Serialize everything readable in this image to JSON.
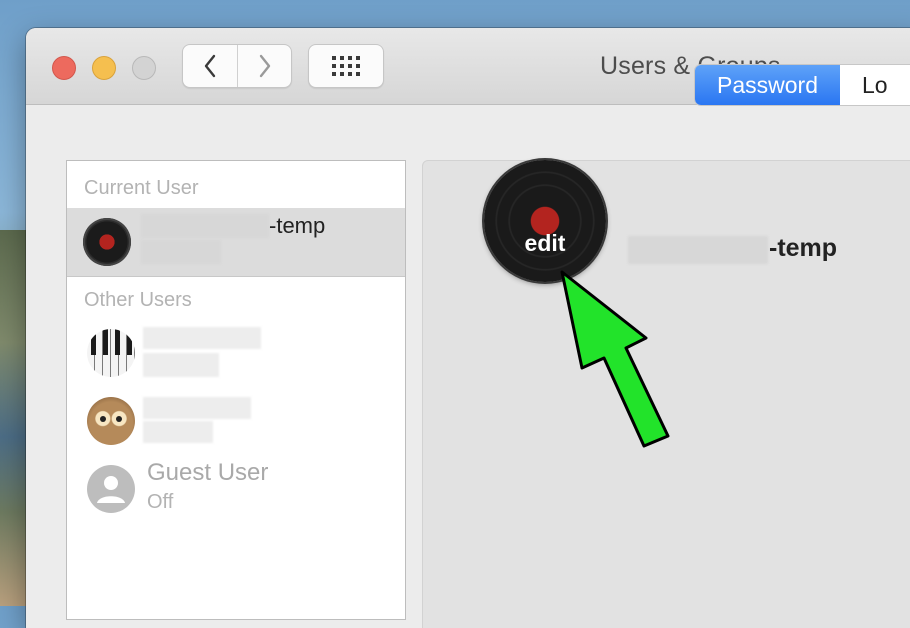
{
  "window": {
    "title": "Users & Groups"
  },
  "colors": {
    "close": "#ed6a5e",
    "minimize": "#f5bf4f",
    "accent": "#2a76f2",
    "arrow": "#22e32a"
  },
  "toolbar": {
    "back_icon": "chevron-left-icon",
    "forward_icon": "chevron-right-icon",
    "grid_icon": "grid-icon"
  },
  "sidebar": {
    "current_user_title": "Current User",
    "current_user_suffix": "-temp",
    "other_users_title": "Other Users",
    "guest": {
      "name": "Guest User",
      "status": "Off"
    }
  },
  "tabs": {
    "active": "Password",
    "inactive": "Lo"
  },
  "pane": {
    "avatar_action": "edit",
    "user_suffix": "-temp"
  }
}
